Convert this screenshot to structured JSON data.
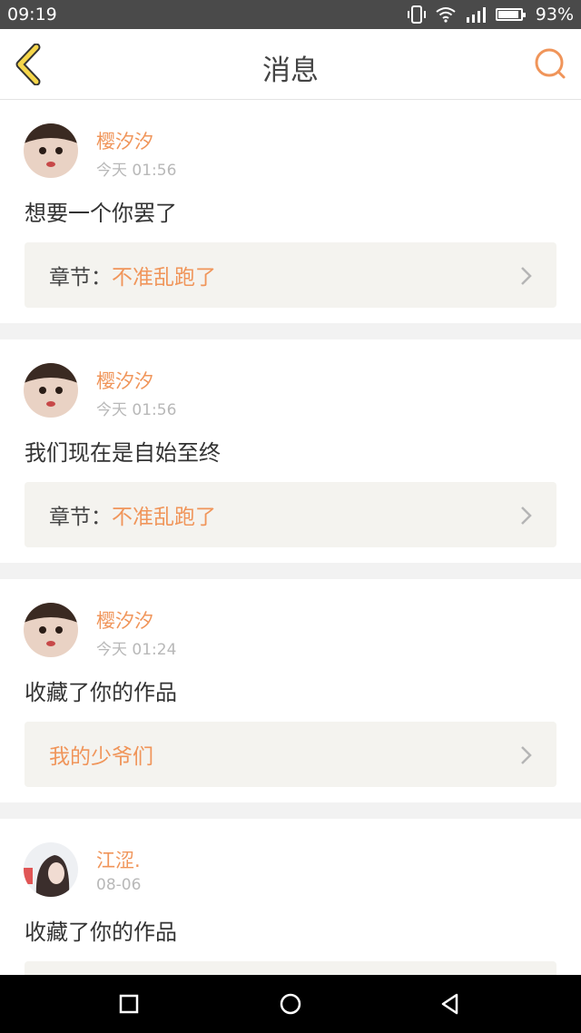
{
  "status_bar": {
    "time": "09:19",
    "battery_percent": "93%",
    "battery_level": 0.93,
    "icons": [
      "vibrate-icon",
      "wifi-icon",
      "signal-icon",
      "battery-icon"
    ]
  },
  "header": {
    "title": "消息",
    "back_icon": "chevron-left-icon",
    "search_icon": "search-icon"
  },
  "colors": {
    "accent": "#f0955a",
    "back_arrow": "#f5d64a",
    "link_box_bg": "#f4f3ef"
  },
  "messages": [
    {
      "user": "樱汐汐",
      "time": "今天 01:56",
      "text": "想要一个你罢了",
      "link_label": "章节：",
      "link_value": "不准乱跑了"
    },
    {
      "user": "樱汐汐",
      "time": "今天 01:56",
      "text": "我们现在是自始至终",
      "link_label": "章节：",
      "link_value": "不准乱跑了"
    },
    {
      "user": "樱汐汐",
      "time": "今天 01:24",
      "text": "收藏了你的作品",
      "link_label": "",
      "link_value": "我的少爷们"
    },
    {
      "user": "江涩.",
      "time": "08-06",
      "text": "收藏了你的作品",
      "link_label": "",
      "link_value": ""
    }
  ],
  "system_nav": {
    "icons": [
      "recent-apps-icon",
      "home-icon",
      "back-triangle-icon"
    ]
  }
}
